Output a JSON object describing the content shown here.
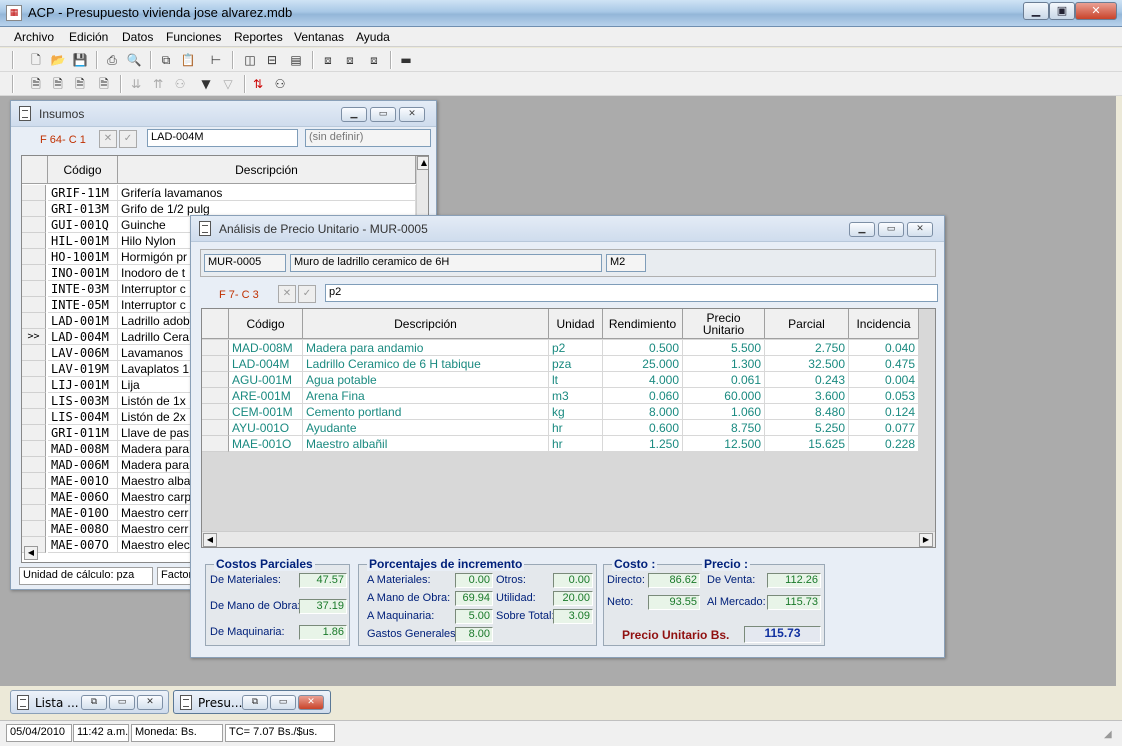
{
  "app": {
    "title": "ACP - Presupuesto vivienda jose alvarez.mdb",
    "icon": "app-icon"
  },
  "menu": [
    "Archivo",
    "Edición",
    "Datos",
    "Funciones",
    "Reportes",
    "Ventanas",
    "Ayuda"
  ],
  "insumos": {
    "title": "Insumos",
    "pos_label": "F 64- C 1",
    "code_value": "LAD-004M",
    "type_placeholder": "(sin definir)",
    "headers": [
      "Código",
      "Descripción"
    ],
    "rows": [
      [
        "",
        "GRIF-11M",
        "Grifería lavamanos"
      ],
      [
        "",
        "GRI-013M",
        "Grifo de 1/2 pulg"
      ],
      [
        "",
        "GUI-001Q",
        "Guinche"
      ],
      [
        "",
        "HIL-001M",
        "Hilo Nylon"
      ],
      [
        "",
        "HO-1001M",
        "Hormigón pr"
      ],
      [
        "",
        "INO-001M",
        "Inodoro de t"
      ],
      [
        "",
        "INTE-03M",
        "Interruptor c"
      ],
      [
        "",
        "INTE-05M",
        "Interruptor c"
      ],
      [
        "",
        "LAD-001M",
        "Ladrillo adob"
      ],
      [
        ">>",
        "LAD-004M",
        "Ladrillo Cera"
      ],
      [
        "",
        "LAV-006M",
        "Lavamanos"
      ],
      [
        "",
        "LAV-019M",
        "Lavaplatos 1"
      ],
      [
        "",
        "LIJ-001M",
        "Lija"
      ],
      [
        "",
        "LIS-003M",
        "Listón de 1x"
      ],
      [
        "",
        "LIS-004M",
        "Listón de 2x"
      ],
      [
        "",
        "GRI-011M",
        "Llave de pas"
      ],
      [
        "",
        "MAD-008M",
        "Madera para"
      ],
      [
        "",
        "MAD-006M",
        "Madera para"
      ],
      [
        "",
        "MAE-001O",
        "Maestro alba"
      ],
      [
        "",
        "MAE-006O",
        "Maestro carp"
      ],
      [
        "",
        "MAE-010O",
        "Maestro cerr"
      ],
      [
        "",
        "MAE-008O",
        "Maestro cerr"
      ],
      [
        "",
        "MAE-007O",
        "Maestro elec"
      ]
    ],
    "footer_unit": "Unidad de cálculo: pza",
    "footer_factor": "Factor"
  },
  "apu": {
    "title": "Análisis de Precio Unitario - MUR-0005",
    "code": "MUR-0005",
    "description": "Muro de ladrillo ceramico de 6H",
    "unit": "M2",
    "pos_label": "F 7- C 3",
    "edit_value": "p2",
    "headers": [
      "Código",
      "Descripción",
      "Unidad",
      "Rendimiento",
      "Precio Unitario",
      "Parcial",
      "Incidencia"
    ],
    "rows": [
      [
        "MAD-008M",
        "Madera para andamio",
        "p2",
        "0.500",
        "5.500",
        "2.750",
        "0.040"
      ],
      [
        "LAD-004M",
        "Ladrillo Ceramico de 6 H tabique",
        "pza",
        "25.000",
        "1.300",
        "32.500",
        "0.475"
      ],
      [
        "AGU-001M",
        "Agua potable",
        "lt",
        "4.000",
        "0.061",
        "0.243",
        "0.004"
      ],
      [
        "ARE-001M",
        "Arena Fina",
        "m3",
        "0.060",
        "60.000",
        "3.600",
        "0.053"
      ],
      [
        "CEM-001M",
        "Cemento portland",
        "kg",
        "8.000",
        "1.060",
        "8.480",
        "0.124"
      ],
      [
        "AYU-001O",
        "Ayudante",
        "hr",
        "0.600",
        "8.750",
        "5.250",
        "0.077"
      ],
      [
        "MAE-001O",
        "Maestro albañil",
        "hr",
        "1.250",
        "12.500",
        "15.625",
        "0.228"
      ]
    ],
    "costos": {
      "title": "Costos Parciales",
      "materiales_lbl": "De Materiales:",
      "materiales": "47.57",
      "mano_lbl": "De Mano de Obra:",
      "mano": "37.19",
      "maquinaria_lbl": "De Maquinaria:",
      "maquinaria": "1.86"
    },
    "porcentajes": {
      "title": "Porcentajes de incremento",
      "mat_lbl": "A Materiales:",
      "mat": "0.00",
      "mano_lbl": "A Mano de Obra:",
      "mano": "69.94",
      "maq_lbl": "A Maquinaria:",
      "maq": "5.00",
      "gg_lbl": "Gastos Generales:",
      "gg": "8.00",
      "otros_lbl": "Otros:",
      "otros": "0.00",
      "util_lbl": "Utilidad:",
      "util": "20.00",
      "sobre_lbl": "Sobre Total:",
      "sobre": "3.09"
    },
    "costo": {
      "title": "Costo :",
      "directo_lbl": "Directo:",
      "directo": "86.62",
      "neto_lbl": "Neto:",
      "neto": "93.55"
    },
    "precio": {
      "title": "Precio :",
      "venta_lbl": "De Venta:",
      "venta": "112.26",
      "mercado_lbl": "Al Mercado:",
      "mercado": "115.73",
      "unit_lbl": "Precio Unitario Bs.",
      "unit": "115.73"
    }
  },
  "taskbar": {
    "t1": "Lista ...",
    "t2": "Presu..."
  },
  "status": {
    "date": "05/04/2010",
    "time": "11:42 a.m.",
    "currency": "Moneda: Bs.",
    "rate": "TC= 7.07 Bs./$us."
  }
}
